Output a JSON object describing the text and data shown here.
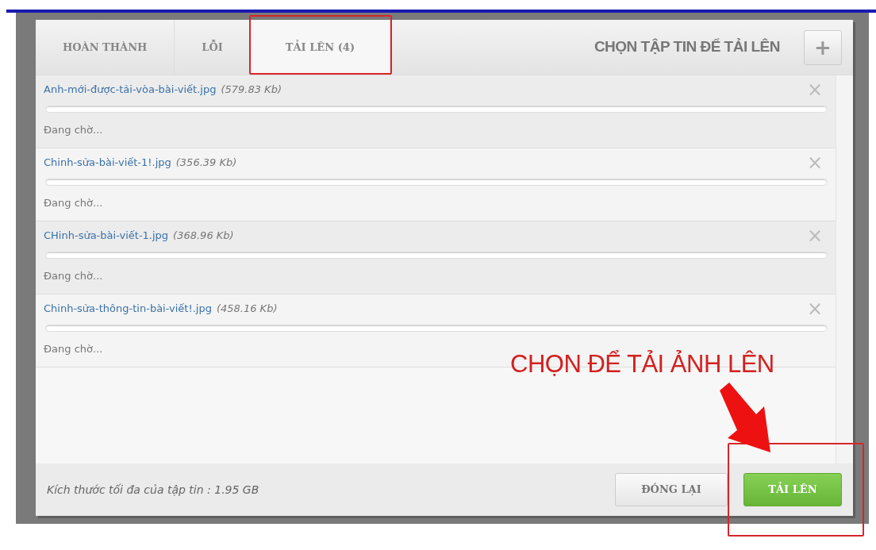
{
  "tabs": [
    {
      "label": "HOÀN THÀNH",
      "selected": false,
      "highlighted": false
    },
    {
      "label": "LỖI",
      "selected": false,
      "highlighted": false
    },
    {
      "label": "TẢI LÊN (4)",
      "selected": true,
      "highlighted": true
    }
  ],
  "choose_files": {
    "label": "CHỌN TẬP TIN ĐỂ TẢI LÊN",
    "button": "+"
  },
  "files": [
    {
      "name": "Anh-mới-được-tải-vòa-bài-viết.jpg",
      "size": "(579.83 Kb)",
      "level": 0,
      "status": "Đang chờ...",
      "close": "×"
    },
    {
      "name": "Chinh-sửa-bài-viết-1!.jpg",
      "size": "(356.39 Kb)",
      "level": 0,
      "status": "Đang chờ...",
      "close": "×"
    },
    {
      "name": "CHinh-sửa-bài-viết-1.jpg",
      "size": "(368.96 Kb)",
      "level": 0,
      "status": "Đang chờ...",
      "close": "×"
    },
    {
      "name": "Chinh-sửa-thông-tin-bài-viết!.jpg",
      "size": "(458.16 Kb)",
      "level": 0,
      "status": "Đang chờ...",
      "close": "×"
    }
  ],
  "footer": {
    "max_size": "Kích thước tối đa của tập tin : 1.95 GB"
  },
  "buttons": [
    {
      "label": "ĐÓNG LẠI",
      "kind": "secondary",
      "highlighted": false
    },
    {
      "label": "TẢI LÊN",
      "kind": "primary",
      "highlighted": true
    }
  ],
  "annotation": {
    "text": "CHỌN ĐỂ TẢI ẢNH LÊN"
  }
}
